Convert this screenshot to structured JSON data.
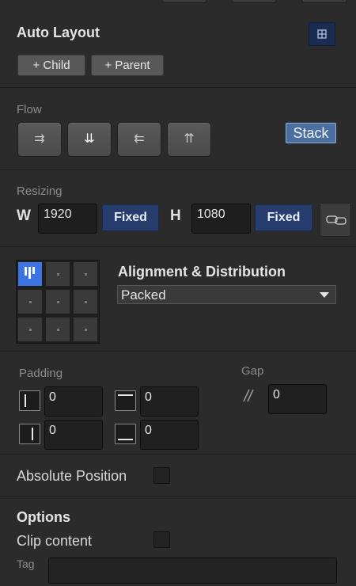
{
  "auto_layout": {
    "title": "Auto Layout",
    "add_child_label": "+ Child",
    "add_parent_label": "+ Parent",
    "layout_icon": "grid-icon"
  },
  "flow": {
    "label": "Flow",
    "buttons": [
      {
        "name": "flow-right",
        "glyph": "⇉"
      },
      {
        "name": "flow-down",
        "glyph": "⇊"
      },
      {
        "name": "flow-left",
        "glyph": "⇇"
      },
      {
        "name": "flow-up",
        "glyph": "⇈"
      }
    ],
    "stack_label": "Stack"
  },
  "resizing": {
    "label": "Resizing",
    "width_letter": "W",
    "width_value": "1920",
    "width_mode": "Fixed",
    "height_letter": "H",
    "height_value": "1080",
    "height_mode": "Fixed",
    "link_icon": "link-icon"
  },
  "alignment": {
    "title": "Alignment & Distribution",
    "mode_value": "Packed",
    "active_cell": "top-left"
  },
  "padding": {
    "label": "Padding",
    "left": "0",
    "top": "0",
    "right": "0",
    "bottom": "0"
  },
  "gap": {
    "label": "Gap",
    "value": "0"
  },
  "absolute_position": {
    "label": "Absolute Position",
    "checked": false
  },
  "options": {
    "title": "Options",
    "clip_content_label": "Clip content",
    "clip_checked": false,
    "tag_label": "Tag",
    "tag_value": ""
  },
  "colors": {
    "panel_bg": "#2b2b2b",
    "accent_blue": "#3e73e6",
    "fixed_badge_bg": "#263d6d",
    "stack_badge_bg": "#4a6fa0"
  }
}
